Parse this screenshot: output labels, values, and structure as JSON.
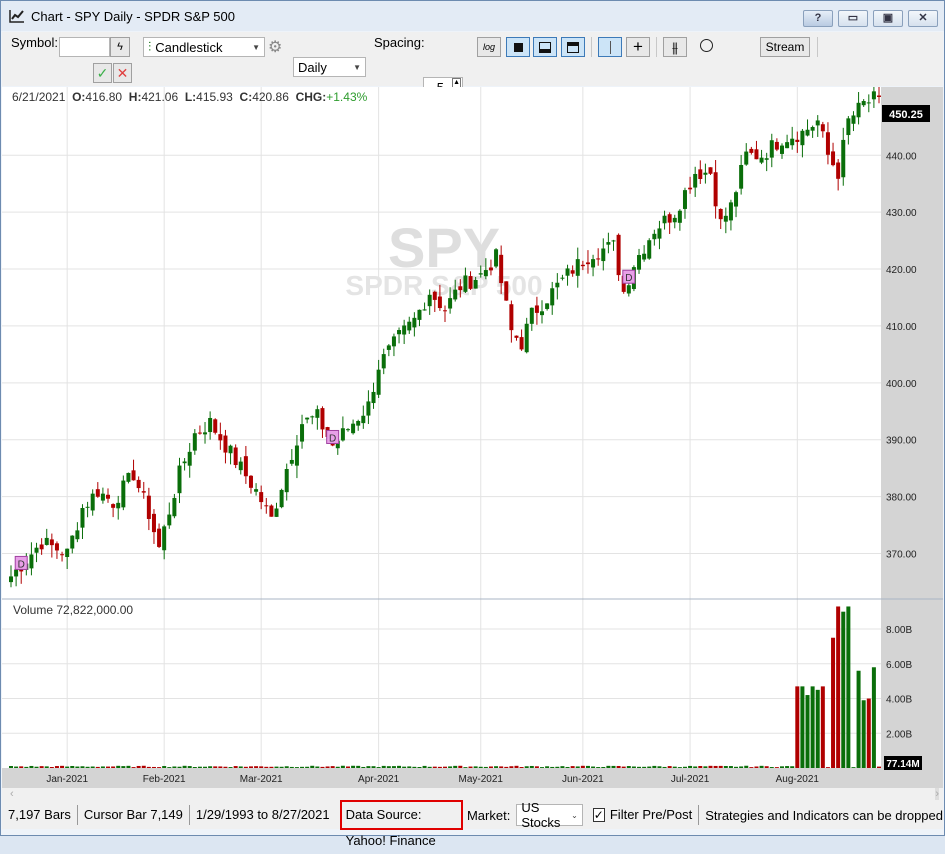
{
  "window": {
    "title": "Chart - SPY Daily - SPDR S&P 500",
    "help": "?",
    "minimize": "▭",
    "restore": "▣",
    "close": "✕"
  },
  "toolbar": {
    "symbol_label": "Symbol:",
    "symbol_value": "",
    "chart_type": "Candlestick",
    "interval": "Daily",
    "spacing_label": "Spacing:",
    "spacing_value": "5",
    "log_label": "log",
    "stream_label": "Stream",
    "formula_value": ""
  },
  "chart": {
    "ohlc_text": {
      "date": "6/21/2021",
      "o_label": "O:",
      "o": "416.80",
      "h_label": "H:",
      "h": "421.06",
      "l_label": "L:",
      "l": "415.93",
      "c_label": "C:",
      "c": "420.86",
      "chg_label": "CHG:",
      "chg": "+1.43%"
    },
    "watermark_symbol": "SPY",
    "watermark_name": "SPDR S&P 500",
    "last_price": "450.25",
    "volume_label": "Volume 72,822,000.00",
    "last_volume": "77.14M",
    "colors": {
      "up": "#0a6e0a",
      "down": "#b00000",
      "grid": "#e3e3e3",
      "axis_bg": "#d4d4d4",
      "chg": "#2e9c2e",
      "dividend": "#e8a0e8"
    },
    "dividend_marker": "D"
  },
  "chart_data": {
    "type": "candlestick",
    "ylim": [
      362,
      452
    ],
    "y_ticks": [
      "370.00",
      "380.00",
      "390.00",
      "400.00",
      "410.00",
      "420.00",
      "430.00",
      "440.00"
    ],
    "y_tick_values": [
      370,
      380,
      390,
      400,
      410,
      420,
      430,
      440
    ],
    "x_ticks": [
      "Jan-2021",
      "Feb-2021",
      "Mar-2021",
      "Apr-2021",
      "May-2021",
      "Jun-2021",
      "Jul-2021",
      "Aug-2021"
    ],
    "x_tick_bar_index": [
      11,
      30,
      49,
      72,
      92,
      112,
      133,
      154
    ],
    "closes_anchor": [
      [
        0,
        366
      ],
      [
        3,
        369
      ],
      [
        6,
        372
      ],
      [
        11,
        370
      ],
      [
        14,
        378
      ],
      [
        17,
        381
      ],
      [
        20,
        379
      ],
      [
        24,
        384
      ],
      [
        27,
        377
      ],
      [
        29,
        371
      ],
      [
        33,
        384
      ],
      [
        36,
        391
      ],
      [
        39,
        393
      ],
      [
        42,
        389
      ],
      [
        45,
        385
      ],
      [
        48,
        381
      ],
      [
        51,
        376
      ],
      [
        54,
        385
      ],
      [
        57,
        393
      ],
      [
        60,
        394
      ],
      [
        63,
        389
      ],
      [
        66,
        392
      ],
      [
        70,
        396
      ],
      [
        72,
        403
      ],
      [
        76,
        408
      ],
      [
        79,
        411
      ],
      [
        82,
        416
      ],
      [
        85,
        413
      ],
      [
        88,
        417
      ],
      [
        92,
        419
      ],
      [
        95,
        422
      ],
      [
        98,
        409
      ],
      [
        100,
        407
      ],
      [
        102,
        412
      ],
      [
        106,
        416
      ],
      [
        110,
        420
      ],
      [
        114,
        423
      ],
      [
        118,
        424
      ],
      [
        120,
        416
      ],
      [
        122,
        421
      ],
      [
        126,
        427
      ],
      [
        130,
        430
      ],
      [
        134,
        437
      ],
      [
        137,
        437
      ],
      [
        139,
        428
      ],
      [
        141,
        431
      ],
      [
        144,
        440
      ],
      [
        147,
        440
      ],
      [
        151,
        443
      ],
      [
        155,
        444
      ],
      [
        158,
        446
      ],
      [
        160,
        440
      ],
      [
        162,
        437
      ],
      [
        164,
        446
      ],
      [
        167,
        449
      ],
      [
        170,
        450.25
      ]
    ],
    "dividend_bars": [
      2,
      63,
      121
    ],
    "volume_ylim": [
      0,
      9.5
    ],
    "volume_ticks": [
      "2.00B",
      "4.00B",
      "6.00B",
      "8.00B"
    ],
    "volume_tick_values": [
      2,
      4,
      6,
      8
    ],
    "volume_tail_billions": [
      4.7,
      4.7,
      4.2,
      4.7,
      4.5,
      4.7,
      0.05,
      7.5,
      9.3,
      9.0,
      9.3,
      0.05,
      5.6,
      3.9,
      4.0,
      5.8,
      0.08
    ]
  },
  "status": {
    "bars": "7,197 Bars",
    "cursor": "Cursor Bar 7,149",
    "range": "1/29/1993 to 8/27/2021",
    "data_source": "Data Source: Yahoo! Finance",
    "market_label": "Market:",
    "market_value": "US Stocks",
    "filter_label": "Filter Pre/Post",
    "hint": "Strategies and Indicators can be dropped"
  }
}
